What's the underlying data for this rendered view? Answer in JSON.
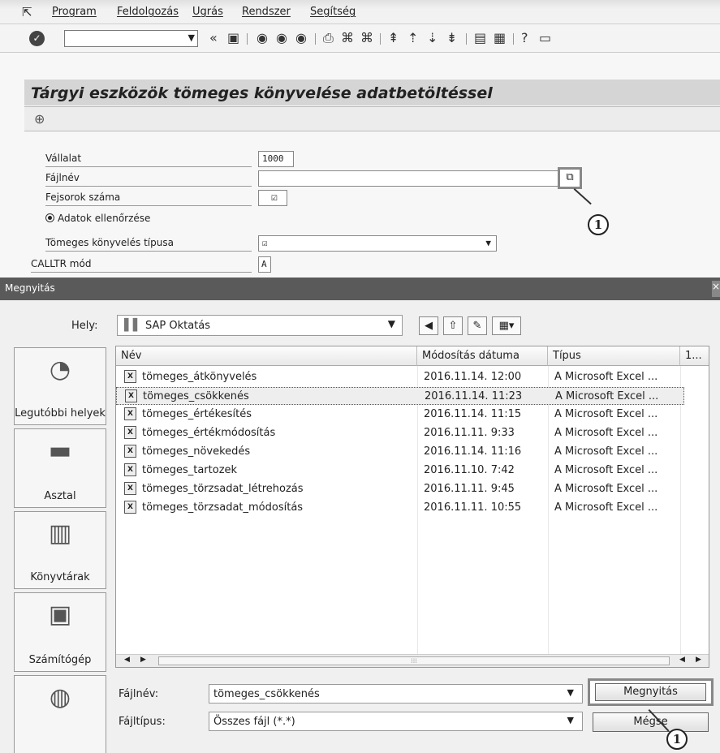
{
  "menu": [
    "Program",
    "Feldolgozás",
    "Ugrás",
    "Rendszer",
    "Segítség"
  ],
  "page": {
    "title": "Tárgyi eszközök tömeges könyvelése adatbetöltéssel"
  },
  "form": {
    "company_label": "Vállalat",
    "company_value": "1000",
    "filename_label": "Fájlnév",
    "filename_value": "",
    "header_rows_label": "Fejsorok száma",
    "header_rows_check": "☑",
    "check_data_label": "Adatok ellenőrzése",
    "posting_type_label": "Tömeges könyvelés típusa",
    "posting_type_value": "☑",
    "calltr_label": "CALLTR mód",
    "calltr_value": "A"
  },
  "callouts": {
    "first": "1",
    "second": "1"
  },
  "dialog": {
    "title": "Megnyitás",
    "look_in_label": "Hely:",
    "look_in_value": "SAP Oktatás",
    "places": [
      "Legutóbbi helyek",
      "Asztal",
      "Könyvtárak",
      "Számítógép"
    ],
    "columns": [
      "Név",
      "Módosítás dátuma",
      "Típus",
      "1..."
    ],
    "files": [
      {
        "name": "tömeges_átkönyvelés",
        "date": "2016.11.14. 12:00",
        "type": "A Microsoft Excel ..."
      },
      {
        "name": "tömeges_csökkenés",
        "date": "2016.11.14. 11:23",
        "type": "A Microsoft Excel ...",
        "selected": true
      },
      {
        "name": "tömeges_értékesítés",
        "date": "2016.11.14. 11:15",
        "type": "A Microsoft Excel ..."
      },
      {
        "name": "tömeges_értékmódosítás",
        "date": "2016.11.11. 9:33",
        "type": "A Microsoft Excel ..."
      },
      {
        "name": "tömeges_növekedés",
        "date": "2016.11.14. 11:16",
        "type": "A Microsoft Excel ..."
      },
      {
        "name": "tömeges_tartozek",
        "date": "2016.11.10. 7:42",
        "type": "A Microsoft Excel ..."
      },
      {
        "name": "tömeges_törzsadat_létrehozás",
        "date": "2016.11.11. 9:45",
        "type": "A Microsoft Excel ..."
      },
      {
        "name": "tömeges_törzsadat_módosítás",
        "date": "2016.11.11. 10:55",
        "type": "A Microsoft Excel ..."
      }
    ],
    "filename_label": "Fájlnév:",
    "filename_value": "tömeges_csökkenés",
    "filetype_label": "Fájltípus:",
    "filetype_value": "Összes fájl (*.*)",
    "open_label": "Megnyitás",
    "cancel_label": "Mégse"
  },
  "icons": [
    "exit-icon",
    "ok-icon",
    "save-icon",
    "back-icon",
    "exit-nav-icon",
    "cancel-icon",
    "print-icon",
    "find-icon",
    "find-next-icon",
    "first-page-icon",
    "prev-page-icon",
    "next-page-icon",
    "last-page-icon",
    "new-session-icon",
    "shortcut-icon",
    "help-icon",
    "customize-icon",
    "execute-icon",
    "value-help-icon",
    "folder-icon",
    "back-nav-icon",
    "up-folder-icon",
    "new-folder-icon",
    "view-menu-icon",
    "excel-file-icon",
    "recent-places-icon",
    "desktop-icon",
    "libraries-icon",
    "computer-icon",
    "network-icon"
  ]
}
